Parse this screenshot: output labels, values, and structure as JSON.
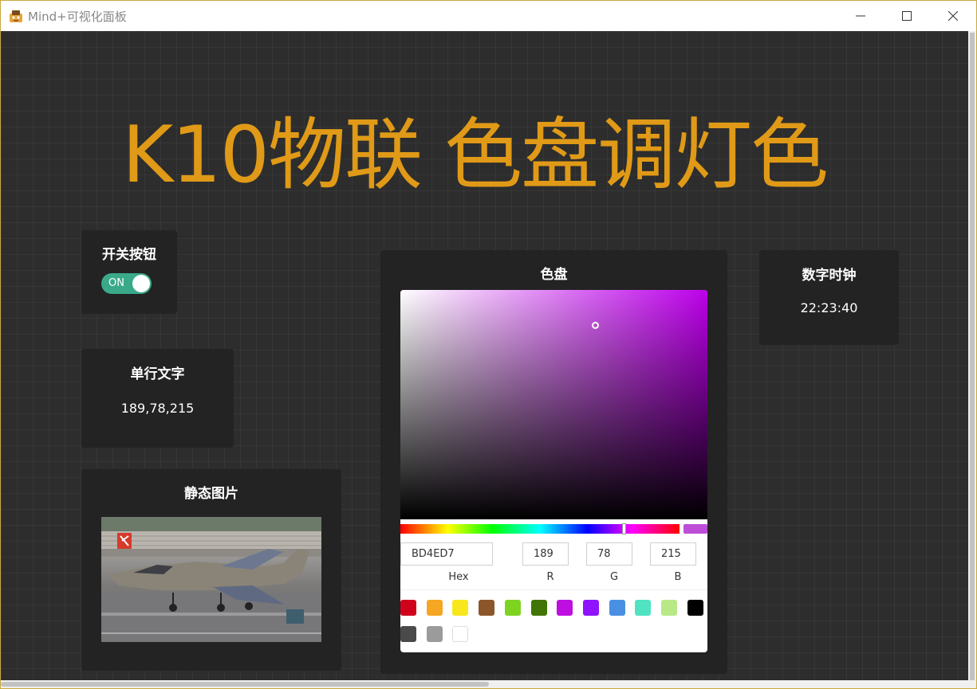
{
  "window": {
    "title": "Mind+可视化面板"
  },
  "main_title": "K10物联 色盘调灯色",
  "switch_card": {
    "title": "开关按钮",
    "switch_label": "ON",
    "state": "on",
    "color": "#3aa98a"
  },
  "text_card": {
    "title": "单行文字",
    "value": "189,78,215"
  },
  "image_card": {
    "title": "静态图片"
  },
  "color_card": {
    "title": "色盘",
    "hex": "BD4ED7",
    "r": "189",
    "g": "78",
    "b": "215",
    "labels": {
      "hex": "Hex",
      "r": "R",
      "g": "G",
      "b": "B"
    },
    "preview_color": "#bd4ed7",
    "swatches": [
      "#d0021b",
      "#f5a623",
      "#f8e71c",
      "#8b572a",
      "#7ed321",
      "#417505",
      "#bd10e0",
      "#9013fe",
      "#4a90e2",
      "#50e3c2",
      "#b8e986",
      "#000000",
      "#4a4a4a",
      "#9b9b9b",
      "#ffffff"
    ]
  },
  "clock_card": {
    "title": "数字时钟",
    "value": "22:23:40"
  },
  "colors": {
    "title_accent": "#e09a17",
    "card_bg": "#232323",
    "canvas_bg": "#2d2d2d"
  }
}
